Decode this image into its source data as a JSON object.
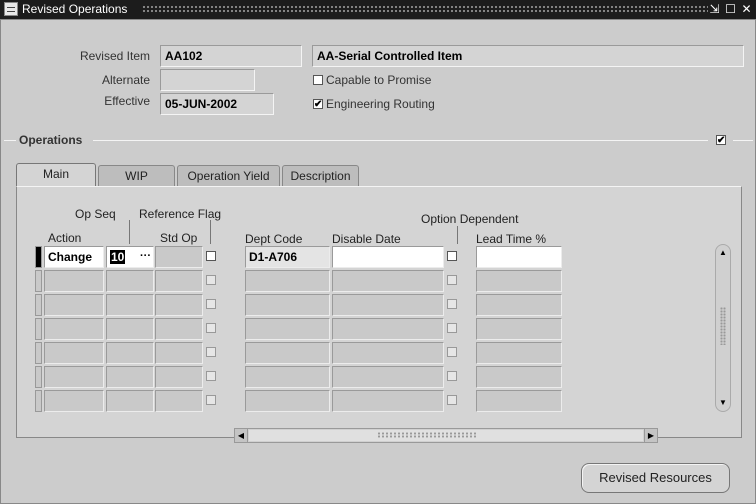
{
  "window": {
    "title": "Revised Operations"
  },
  "header": {
    "revised_item_label": "Revised Item",
    "revised_item_value": "AA102",
    "revised_item_desc": "AA-Serial Controlled Item",
    "alternate_label": "Alternate",
    "alternate_value": "",
    "effective_label": "Effective",
    "effective_value": "05-JUN-2002",
    "capable_to_promise_label": "Capable to Promise",
    "capable_to_promise_checked": false,
    "engineering_routing_label": "Engineering Routing",
    "engineering_routing_checked": true
  },
  "section": {
    "title": "Operations",
    "checkbox_checked": true
  },
  "tabs": [
    {
      "label": "Main",
      "active": true
    },
    {
      "label": "WIP",
      "active": false
    },
    {
      "label": "Operation Yield",
      "active": false
    },
    {
      "label": "Description",
      "active": false
    }
  ],
  "columns": {
    "action": "Action",
    "op_seq": "Op Seq",
    "reference_flag": "Reference Flag",
    "std_op": "Std Op",
    "dept_code": "Dept Code",
    "disable_date": "Disable Date",
    "option_dependent": "Option Dependent",
    "lead_time": "Lead Time %"
  },
  "rows": [
    {
      "action": "Change",
      "op_seq": "10",
      "std_op": "",
      "dept_code": "D1-A706",
      "disable_date": "",
      "lead_time": ""
    },
    {
      "action": "",
      "op_seq": "",
      "std_op": "",
      "dept_code": "",
      "disable_date": "",
      "lead_time": ""
    },
    {
      "action": "",
      "op_seq": "",
      "std_op": "",
      "dept_code": "",
      "disable_date": "",
      "lead_time": ""
    },
    {
      "action": "",
      "op_seq": "",
      "std_op": "",
      "dept_code": "",
      "disable_date": "",
      "lead_time": ""
    },
    {
      "action": "",
      "op_seq": "",
      "std_op": "",
      "dept_code": "",
      "disable_date": "",
      "lead_time": ""
    },
    {
      "action": "",
      "op_seq": "",
      "std_op": "",
      "dept_code": "",
      "disable_date": "",
      "lead_time": ""
    },
    {
      "action": "",
      "op_seq": "",
      "std_op": "",
      "dept_code": "",
      "disable_date": "",
      "lead_time": ""
    }
  ],
  "buttons": {
    "revised_resources": "Revised Resources"
  },
  "icons": {
    "app": "app-menu-icon",
    "minimize": "minimize-icon",
    "maximize": "maximize-icon",
    "close": "close-icon",
    "lov": "ellipsis-icon"
  }
}
